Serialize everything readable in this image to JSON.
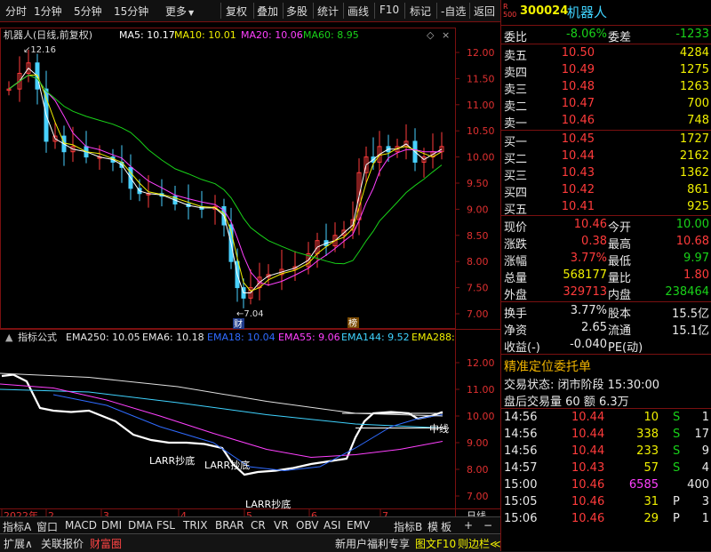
{
  "toolbar": {
    "left_items": [
      "分时",
      "1分钟",
      "5分钟",
      "15分钟",
      "更多"
    ],
    "right_items": [
      "复权",
      "叠加",
      "多股",
      "统计",
      "画线",
      "F10",
      "标记",
      "-自选",
      "返回"
    ]
  },
  "main_chart": {
    "title": "机器人(日线,前复权)",
    "ma_labels": [
      {
        "text": "MA5: 10.17",
        "color": "#ffffff"
      },
      {
        "text": "MA10: 10.01",
        "color": "#f0f000"
      },
      {
        "text": "MA20: 10.06",
        "color": "#ff40ff"
      },
      {
        "text": "MA60: 8.95",
        "color": "#19d219"
      }
    ],
    "y_ticks": [
      "12.00",
      "11.50",
      "11.00",
      "10.50",
      "10.00",
      "9.50",
      "9.00",
      "8.50",
      "8.00",
      "7.50",
      "7.00"
    ],
    "high_label": "12.16",
    "low_label": "7.04",
    "markers": [
      "财",
      "榜"
    ]
  },
  "indicator_chart": {
    "title": "指标公式",
    "labels": [
      {
        "text": "EMA250: 10.05",
        "color": "#e8e8e8"
      },
      {
        "text": "EMA6: 10.18",
        "color": "#e8e8e8"
      },
      {
        "text": "EMA18: 10.04",
        "color": "#2f6bff"
      },
      {
        "text": "EMA55: 9.06",
        "color": "#ff40ff"
      },
      {
        "text": "EMA144: 9.52",
        "color": "#3fd3ff"
      },
      {
        "text": "EMA288:",
        "color": "#f0f000"
      }
    ],
    "y_ticks": [
      "12.00",
      "11.00",
      "10.00",
      "9.00",
      "8.00",
      "7.00"
    ],
    "annotations": [
      "LARR抄底",
      "LARR抄底",
      "LARR抄底",
      "中线"
    ]
  },
  "x_axis": {
    "labels": [
      "2022年",
      "2",
      "3",
      "4",
      "5",
      "6",
      "7"
    ],
    "period": "日线"
  },
  "bottom_tabs": [
    "指标A",
    "窗口",
    "MACD",
    "DMI",
    "DMA",
    "FSL",
    "TRIX",
    "BRAR",
    "CR",
    "VR",
    "OBV",
    "ASI",
    "EMV"
  ],
  "bottom_tabs_right": [
    "指标B",
    "模",
    "板",
    "+",
    "−"
  ],
  "status_bar": {
    "left": [
      "扩展∧",
      "关联报价",
      "财富圈"
    ],
    "right": [
      "新用户福利专享",
      "图文F10",
      "则边栏≪"
    ],
    "nav": [
      "笔",
      "价",
      "细",
      "势",
      "联",
      "值",
      "主",
      "筹"
    ]
  },
  "quote": {
    "code": "300024",
    "name": "机器人",
    "badge_top": "R",
    "badge_bottom": "500",
    "wei_bi_label": "委比",
    "wei_bi": "-8.06%",
    "wei_cha_label": "委差",
    "wei_cha": "-1233",
    "asks": [
      {
        "label": "卖五",
        "price": "10.50",
        "vol": "4284"
      },
      {
        "label": "卖四",
        "price": "10.49",
        "vol": "1275"
      },
      {
        "label": "卖三",
        "price": "10.48",
        "vol": "1263"
      },
      {
        "label": "卖二",
        "price": "10.47",
        "vol": "700"
      },
      {
        "label": "卖一",
        "price": "10.46",
        "vol": "748"
      }
    ],
    "bids": [
      {
        "label": "买一",
        "price": "10.45",
        "vol": "1727"
      },
      {
        "label": "买二",
        "price": "10.44",
        "vol": "2162"
      },
      {
        "label": "买三",
        "price": "10.43",
        "vol": "1362"
      },
      {
        "label": "买四",
        "price": "10.42",
        "vol": "861"
      },
      {
        "label": "买五",
        "price": "10.41",
        "vol": "925"
      }
    ],
    "stats": [
      {
        "l1": "现价",
        "v1": "10.46",
        "c1": "red",
        "l2": "今开",
        "v2": "10.00",
        "c2": "green"
      },
      {
        "l1": "涨跌",
        "v1": "0.38",
        "c1": "red",
        "l2": "最高",
        "v2": "10.68",
        "c2": "red"
      },
      {
        "l1": "涨幅",
        "v1": "3.77%",
        "c1": "red",
        "l2": "最低",
        "v2": "9.97",
        "c2": "green"
      },
      {
        "l1": "总量",
        "v1": "568177",
        "c1": "yellow",
        "l2": "量比",
        "v2": "1.80",
        "c2": "red"
      },
      {
        "l1": "外盘",
        "v1": "329713",
        "c1": "red",
        "l2": "内盘",
        "v2": "238464",
        "c2": "green"
      }
    ],
    "stats2": [
      {
        "l1": "换手",
        "v1": "3.77%",
        "l2": "股本",
        "v2": "15.5亿"
      },
      {
        "l1": "净资",
        "v1": "2.65",
        "l2": "流通",
        "v2": "15.1亿"
      },
      {
        "l1": "收益(-)",
        "v1": "-0.040",
        "l2": "PE(动)",
        "v2": ""
      }
    ],
    "precise_title": "精准定位委托单",
    "trade_status": "交易状态: 闭市阶段 15:30:00",
    "after_hours": "盘后交易量 60 额 6.3万",
    "ticks": [
      {
        "time": "14:56",
        "price": "10.44",
        "vol": "10",
        "vc": "yellow",
        "bs": "S",
        "n": "1"
      },
      {
        "time": "14:56",
        "price": "10.44",
        "vol": "338",
        "vc": "yellow",
        "bs": "S",
        "n": "17"
      },
      {
        "time": "14:56",
        "price": "10.44",
        "vol": "233",
        "vc": "yellow",
        "bs": "S",
        "n": "9"
      },
      {
        "time": "14:57",
        "price": "10.43",
        "vol": "57",
        "vc": "yellow",
        "bs": "S",
        "n": "4"
      },
      {
        "time": "15:00",
        "price": "10.46",
        "vol": "6585",
        "vc": "magenta",
        "bs": "",
        "n": "400"
      },
      {
        "time": "15:05",
        "price": "10.46",
        "vol": "31",
        "vc": "yellow",
        "bs": "P",
        "n": "3"
      },
      {
        "time": "15:06",
        "price": "10.46",
        "vol": "29",
        "vc": "yellow",
        "bs": "P",
        "n": "1"
      }
    ]
  }
}
